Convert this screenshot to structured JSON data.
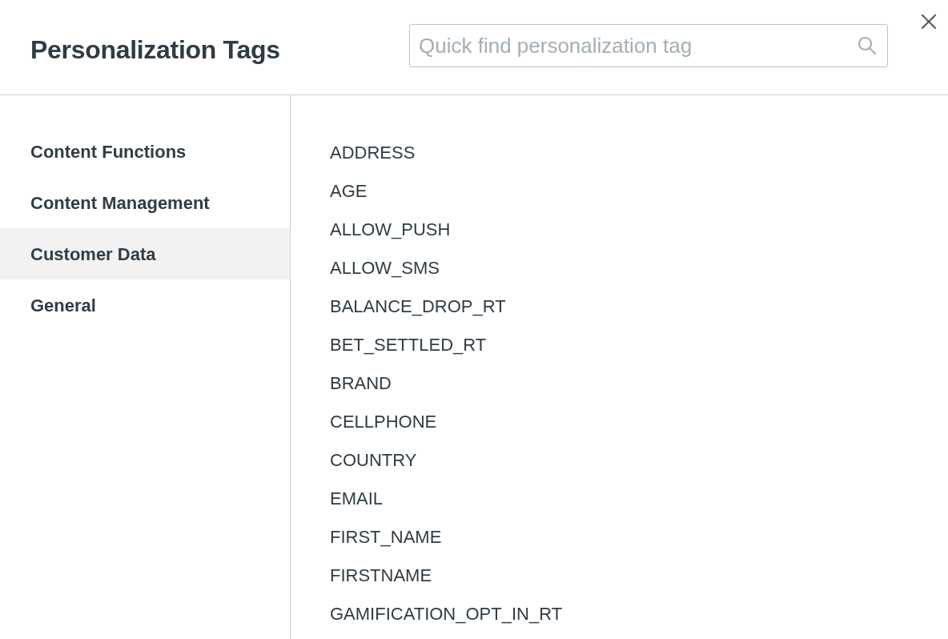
{
  "dialog": {
    "title": "Personalization Tags"
  },
  "search": {
    "placeholder": "Quick find personalization tag"
  },
  "sidebar": {
    "items": [
      {
        "label": "Content Functions",
        "selected": false
      },
      {
        "label": "Content Management",
        "selected": false
      },
      {
        "label": "Customer Data",
        "selected": true
      },
      {
        "label": "General",
        "selected": false
      }
    ]
  },
  "tags": [
    "ADDRESS",
    "AGE",
    "ALLOW_PUSH",
    "ALLOW_SMS",
    "BALANCE_DROP_RT",
    "BET_SETTLED_RT",
    "BRAND",
    "CELLPHONE",
    "COUNTRY",
    "EMAIL",
    "FIRST_NAME",
    "FIRSTNAME",
    "GAMIFICATION_OPT_IN_RT"
  ]
}
